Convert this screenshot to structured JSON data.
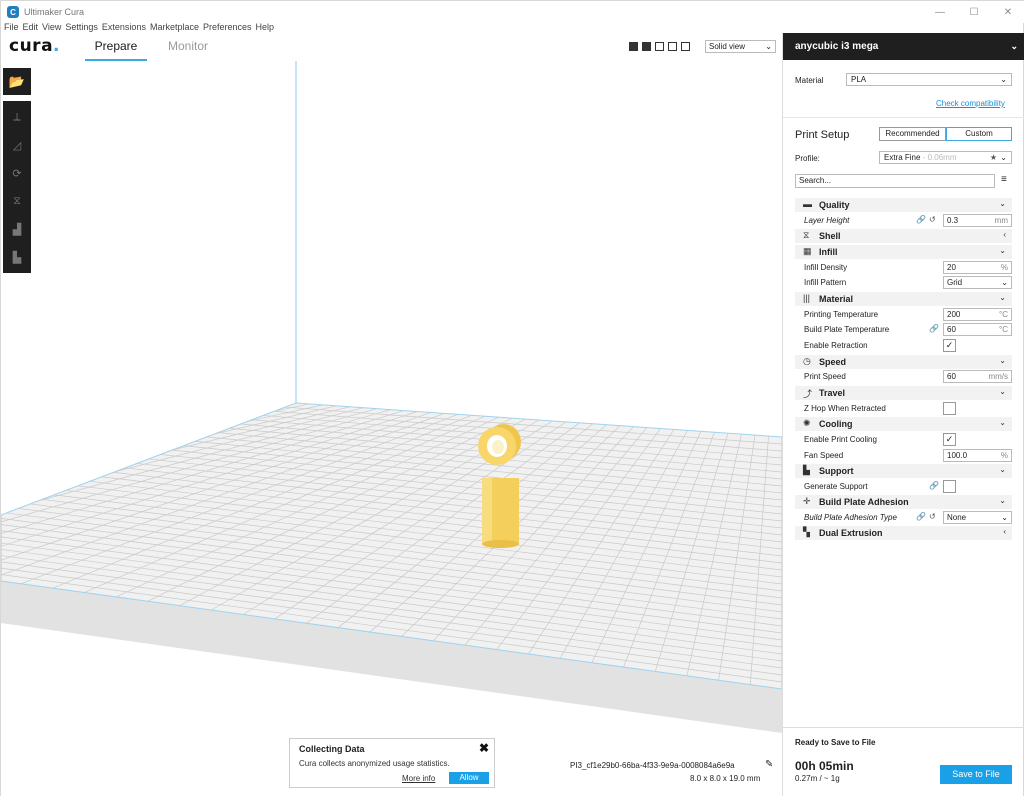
{
  "window": {
    "title": "Ultimaker Cura",
    "minimize": "—",
    "maximize": "☐",
    "close": "✕"
  },
  "menubar": [
    "File",
    "Edit",
    "View",
    "Settings",
    "Extensions",
    "Marketplace",
    "Preferences",
    "Help"
  ],
  "header": {
    "logo": "cura",
    "logo_dot": ".",
    "tabs": {
      "prepare": "Prepare",
      "monitor": "Monitor"
    },
    "view_mode": "Solid view"
  },
  "colors": {
    "accent": "#3ea8e6",
    "button_blue": "#1aa0e6",
    "dark_bar": "#1f1f1f",
    "model": "#f8d66a",
    "build_plate": "#f0f0f0",
    "grid_line": "#c8c8c8"
  },
  "left_toolbar": {
    "open_icon": "folder-open-icon",
    "tools": [
      "move-icon",
      "scale-icon",
      "rotate-icon",
      "mirror-icon",
      "per-model-settings-icon",
      "support-blocker-icon"
    ]
  },
  "collect_popup": {
    "title": "Collecting Data",
    "text": "Cura collects anonymized usage statistics.",
    "more_info": "More info",
    "allow": "Allow",
    "close": "✖"
  },
  "job": {
    "name": "PI3_cf1e29b0-66ba-4f33-9e9a-0008084a6e9a",
    "dimensions": "8.0 x 8.0 x 19.0 mm"
  },
  "sidebar": {
    "machine": "anycubic i3 mega",
    "material_label": "Material",
    "material_value": "PLA",
    "check_compat": "Check compatibility",
    "print_setup": "Print Setup",
    "mode_recommended": "Recommended",
    "mode_custom": "Custom",
    "profile_label": "Profile:",
    "profile_value": "Extra Fine",
    "profile_detail": "- 0.06mm",
    "search_placeholder": "Search...",
    "categories": {
      "quality": "Quality",
      "shell": "Shell",
      "infill": "Infill",
      "material": "Material",
      "speed": "Speed",
      "travel": "Travel",
      "cooling": "Cooling",
      "support": "Support",
      "adhesion": "Build Plate Adhesion",
      "dual": "Dual Extrusion"
    },
    "settings": {
      "layer_height": {
        "label": "Layer Height",
        "value": "0.3",
        "unit": "mm"
      },
      "infill_density": {
        "label": "Infill Density",
        "value": "20",
        "unit": "%"
      },
      "infill_pattern": {
        "label": "Infill Pattern",
        "value": "Grid"
      },
      "print_temp": {
        "label": "Printing Temperature",
        "value": "200",
        "unit": "°C"
      },
      "bed_temp": {
        "label": "Build Plate Temperature",
        "value": "60",
        "unit": "°C"
      },
      "retraction": {
        "label": "Enable Retraction",
        "checked": "✓"
      },
      "print_speed": {
        "label": "Print Speed",
        "value": "60",
        "unit": "mm/s"
      },
      "z_hop": {
        "label": "Z Hop When Retracted",
        "checked": ""
      },
      "print_cooling": {
        "label": "Enable Print Cooling",
        "checked": "✓"
      },
      "fan_speed": {
        "label": "Fan Speed",
        "value": "100.0",
        "unit": "%"
      },
      "gen_support": {
        "label": "Generate Support",
        "checked": ""
      },
      "adhesion_type": {
        "label": "Build Plate Adhesion Type",
        "value": "None"
      }
    },
    "footer": {
      "ready": "Ready to Save to File",
      "time": "00h 05min",
      "usage": "0.27m / ~ 1g",
      "save": "Save to File"
    }
  }
}
